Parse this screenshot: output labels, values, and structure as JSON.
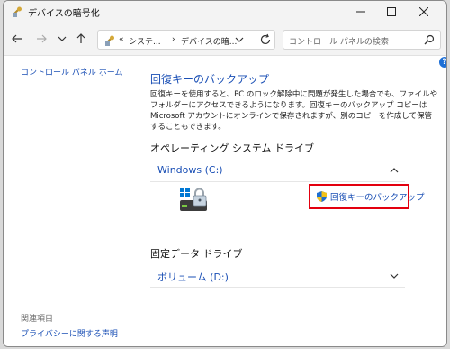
{
  "window": {
    "title": "デバイスの暗号化"
  },
  "nav": {
    "path_overflow": "«",
    "path_item_1": "システ...",
    "path_sep": "›",
    "path_item_2": "デバイスの暗...",
    "search_placeholder": "コントロール パネルの検索"
  },
  "sidebar": {
    "home": "コントロール パネル ホーム",
    "related_heading": "関連項目",
    "privacy_link": "プライバシーに関する声明"
  },
  "help_label": "?",
  "main": {
    "title": "回復キーのバックアップ",
    "description": "回復キーを使用すると、PC のロック解除中に問題が発生した場合でも、ファイルやフォルダーにアクセスできるようになります。回復キーのバックアップ コピーは Microsoft アカウントにオンラインで保存されますが、別のコピーを作成して保管することもできます。",
    "os_drive_heading": "オペレーティング システム ドライブ",
    "os_drive_label": "Windows (C:)",
    "backup_link": "回復キーのバックアップ",
    "fixed_drive_heading": "固定データ ドライブ",
    "fixed_drive_label": "ボリューム (D:)"
  },
  "colors": {
    "link": "#1a4fb5",
    "highlight": "#e3000f"
  },
  "icons": {
    "app": "key-shield-icon",
    "back": "arrow-left-icon",
    "forward": "arrow-right-icon",
    "recent": "chevron-down-icon",
    "up": "arrow-up-icon",
    "refresh": "refresh-icon",
    "search": "search-icon",
    "drive": "locked-drive-icon",
    "shield": "uac-shield-icon"
  }
}
